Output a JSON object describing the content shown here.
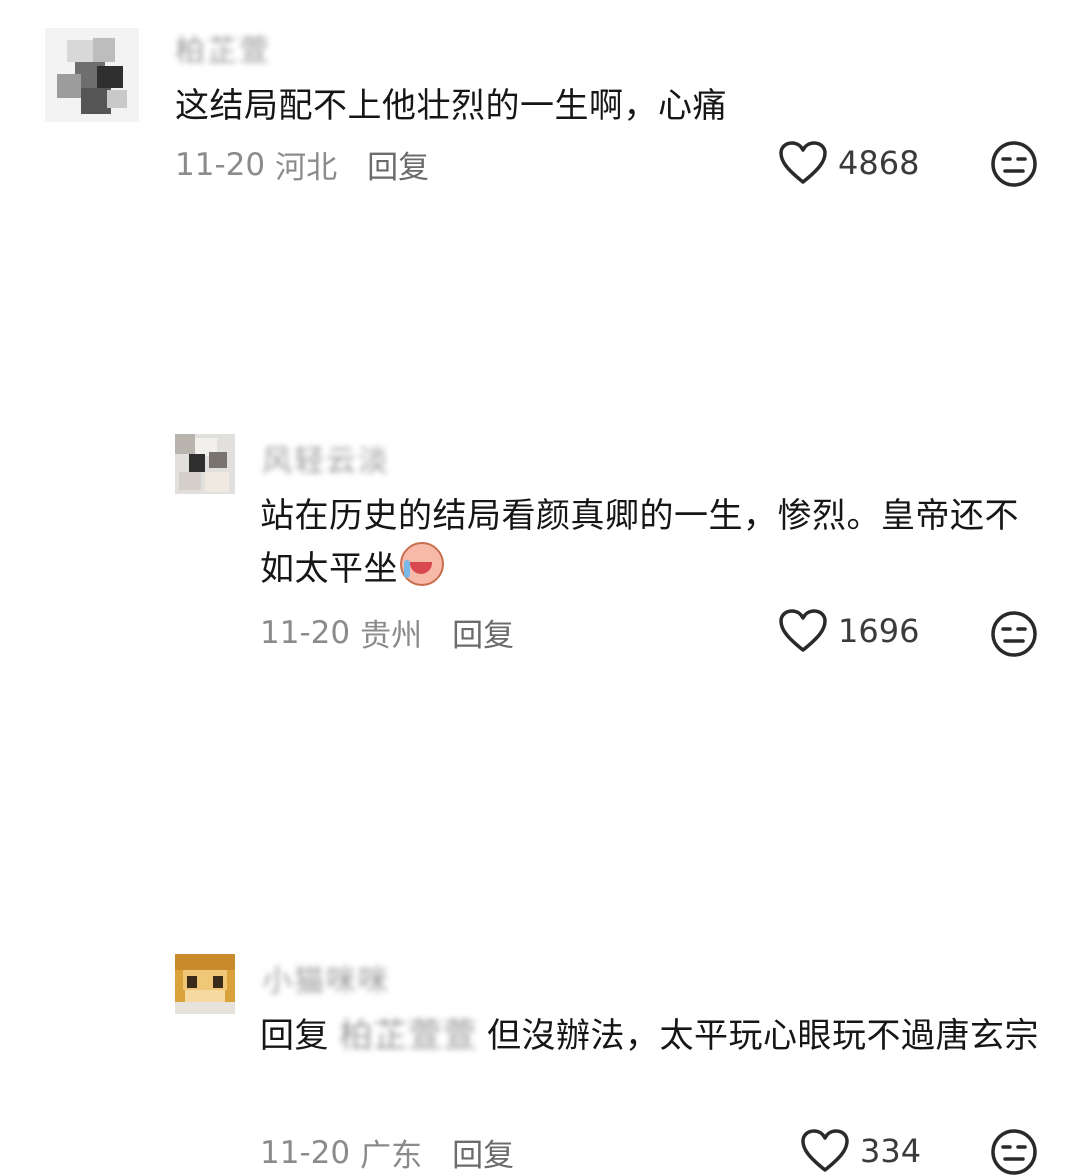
{
  "comments": [
    {
      "username": "柏芷萱",
      "text": "这结局配不上他壮烈的一生啊，心痛",
      "date": "11-20",
      "location": "河北",
      "reply_label": "回复",
      "likes": "4868",
      "icons": {
        "like": "heart-outline-icon",
        "dislike": "neutral-face-icon"
      }
    },
    {
      "username": "风轻云淡",
      "text": "站在历史的结局看颜真卿的一生，惨烈。皇帝还不如太平坐",
      "emoji": "crying-face-emoji",
      "date": "11-20",
      "location": "贵州",
      "reply_label": "回复",
      "likes": "1696",
      "icons": {
        "like": "heart-outline-icon",
        "dislike": "neutral-face-icon"
      }
    },
    {
      "username": "小猫咪咪",
      "reply_prefix": "回复",
      "mention": "柏芷萱萱",
      "text": "但沒辦法，太平玩心眼玩不過唐玄宗",
      "date": "11-20",
      "location": "广东",
      "reply_label": "回复",
      "likes": "334",
      "icons": {
        "like": "heart-outline-icon",
        "dislike": "neutral-face-icon"
      }
    }
  ]
}
